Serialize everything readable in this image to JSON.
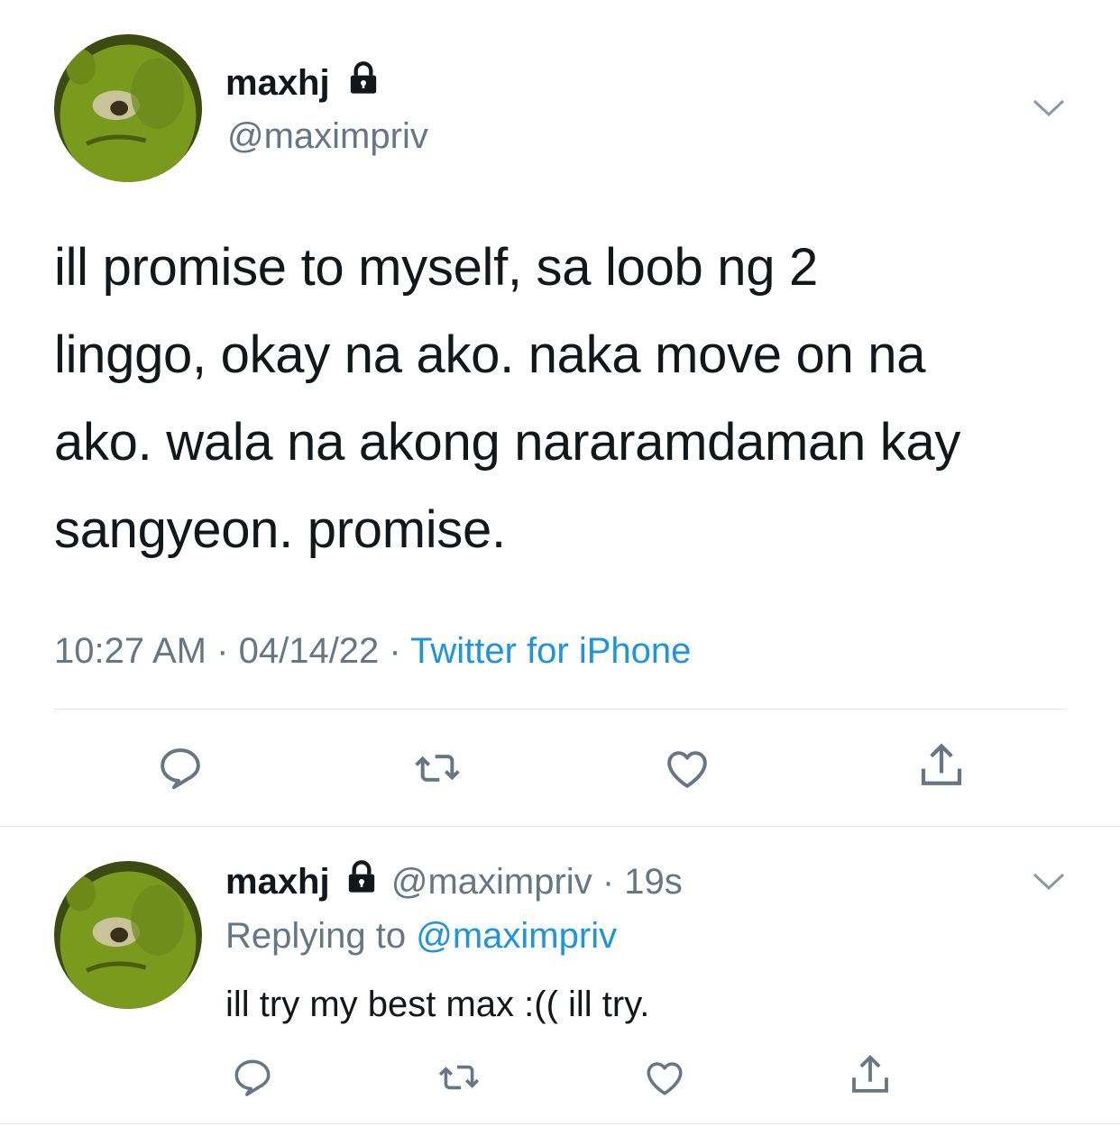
{
  "main_tweet": {
    "display_name": "maxhj",
    "handle": "@maximpriv",
    "text": "ill promise to myself, sa loob ng 2 linggo, okay na ako. naka move on na ako. wala na akong nararamdaman kay sangyeon. promise.",
    "text_lines": [
      "ill promise to myself, sa loob ng 2",
      "linggo, okay na ako. naka move on na",
      "ako. wala na akong nararamdaman kay",
      "sangyeon. promise."
    ],
    "time": "10:27 AM",
    "sep1": "·",
    "date": "04/14/22",
    "sep2": "·",
    "source": "Twitter for iPhone",
    "icons": [
      "reply-icon",
      "retweet-icon",
      "like-icon",
      "share-icon"
    ]
  },
  "reply_tweet": {
    "display_name": "maxhj",
    "handle": "@maximpriv",
    "sep": "·",
    "age": "19s",
    "replying_prefix": "Replying to",
    "replying_to": "@maximpriv",
    "text": "ill try my best max :(( ill try.",
    "icons": [
      "reply-icon",
      "retweet-icon",
      "like-icon",
      "share-icon"
    ]
  },
  "colors": {
    "text": "#14171a",
    "secondary": "#657786",
    "link": "#1b95e0",
    "divider": "#e1e8ed",
    "avatar_green": "#7a9a1e"
  }
}
